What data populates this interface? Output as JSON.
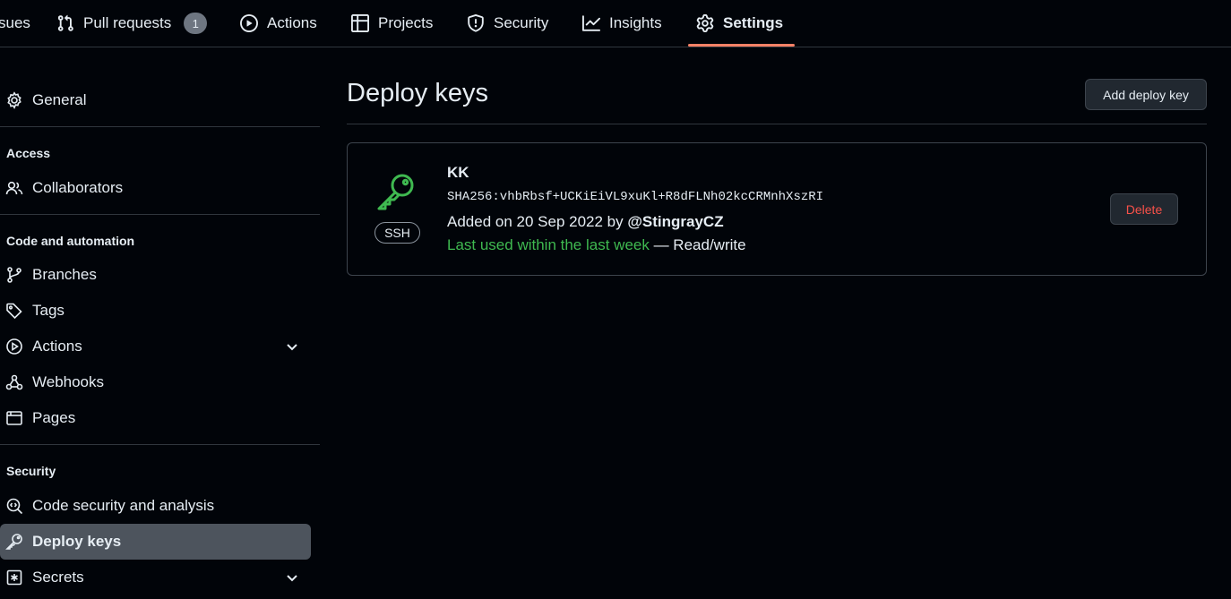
{
  "topnav": {
    "issues_label": "sues",
    "pulls_label": "Pull requests",
    "pulls_count": "1",
    "actions_label": "Actions",
    "projects_label": "Projects",
    "security_label": "Security",
    "insights_label": "Insights",
    "settings_label": "Settings"
  },
  "sidebar": {
    "general": "General",
    "access_heading": "Access",
    "collaborators": "Collaborators",
    "code_heading": "Code and automation",
    "branches": "Branches",
    "tags": "Tags",
    "actions": "Actions",
    "webhooks": "Webhooks",
    "pages": "Pages",
    "security_heading": "Security",
    "code_security": "Code security and analysis",
    "deploy_keys": "Deploy keys",
    "secrets": "Secrets"
  },
  "main": {
    "title": "Deploy keys",
    "add_button": "Add deploy key",
    "key": {
      "name": "KK",
      "badge": "SSH",
      "fingerprint": "SHA256:vhbRbsf+UCKiEiVL9xuKl+R8dFLNh02kcCRMnhXszRI",
      "added_prefix": "Added on 20 Sep 2022 by ",
      "added_by": "@StingrayCZ",
      "last_used": "Last used within the last week",
      "access": " — Read/write",
      "delete_button": "Delete"
    }
  },
  "colors": {
    "background": "#010409",
    "accent_underline": "#f78166",
    "success_green": "#3fb950",
    "danger_red": "#f85149"
  }
}
